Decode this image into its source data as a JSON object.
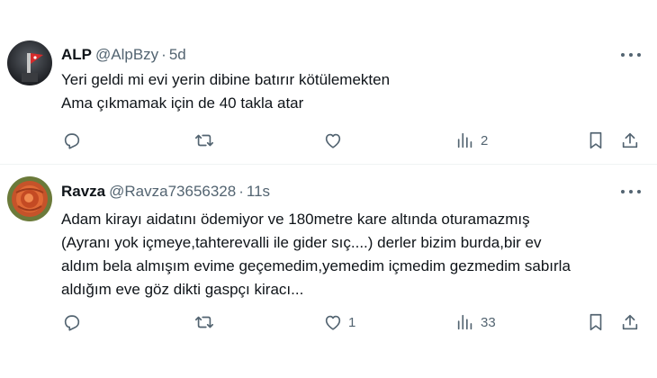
{
  "tweets": [
    {
      "name": "ALP",
      "handle": "@AlpBzy",
      "separator": "·",
      "time": "5d",
      "lines": [
        "Yeri geldi mi evi yerin dibine batırır kötülemekten",
        "Ama çıkmamak için de 40 takla atar"
      ],
      "likes": "",
      "views": "2"
    },
    {
      "name": "Ravza",
      "handle": "@Ravza73656328",
      "separator": "·",
      "time": "11s",
      "lines": [
        "Adam kirayı aidatını ödemiyor ve 180metre kare altında oturamazmış",
        "(Ayranı yok içmeye,tahterevalli ile gider sıç....) derler bizim burda,bir ev",
        "aldım bela almışım evime geçemedim,yemedim içmedim gezmedim sabırla",
        "aldığım eve göz dikti gaspçı kiracı..."
      ],
      "likes": "1",
      "views": "33"
    }
  ],
  "icons": {
    "reply": "reply-icon",
    "retweet": "retweet-icon",
    "like": "heart-icon",
    "views": "views-icon",
    "bookmark": "bookmark-icon",
    "share": "share-icon",
    "more": "more-icon"
  },
  "colors": {
    "text": "#0f1419",
    "secondary": "#536471",
    "divider": "#eff3f4"
  }
}
